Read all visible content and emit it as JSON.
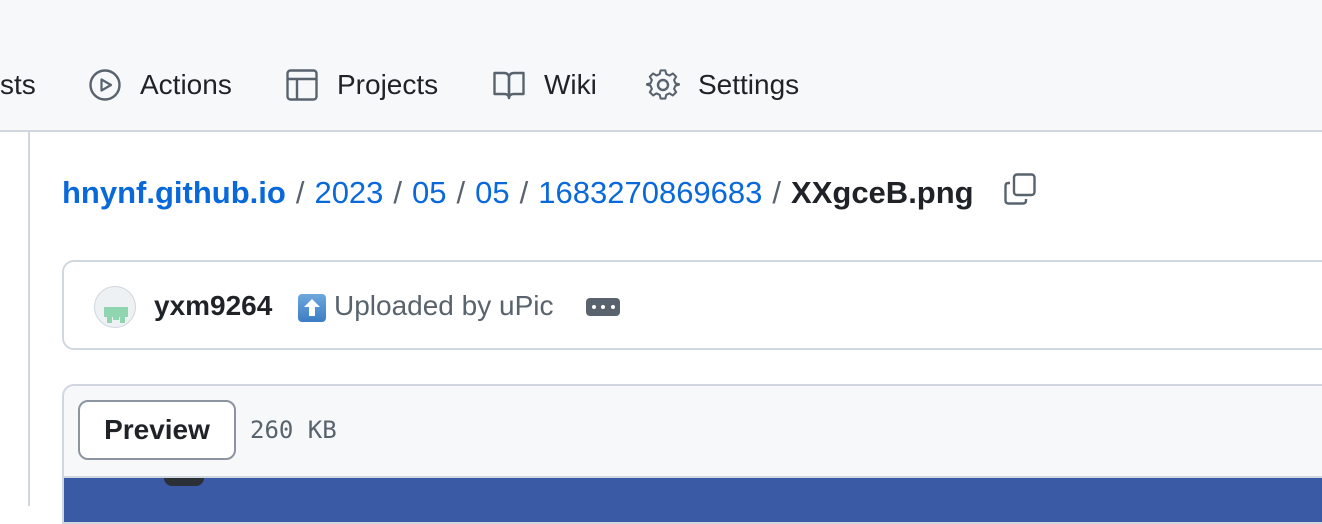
{
  "nav": {
    "items": [
      {
        "label": "sts",
        "icon": "pull-request-icon"
      },
      {
        "label": "Actions",
        "icon": "play-icon"
      },
      {
        "label": "Projects",
        "icon": "table-icon"
      },
      {
        "label": "Wiki",
        "icon": "book-icon"
      },
      {
        "label": "Settings",
        "icon": "gear-icon"
      }
    ]
  },
  "breadcrumb": {
    "repo": "hnynf.github.io",
    "path": [
      "2023",
      "05",
      "05",
      "1683270869683"
    ],
    "current": "XXgceB.png",
    "separator": "/",
    "copy_icon": "copy-icon"
  },
  "commit": {
    "author": "yxm9264",
    "emoji": "up-arrow-emoji",
    "message": "Uploaded by uPic",
    "more_icon": "ellipsis-icon"
  },
  "file": {
    "preview_label": "Preview",
    "size": "260 KB"
  },
  "colors": {
    "link": "#0969da",
    "text": "#1f2328",
    "muted": "#59636e",
    "border": "#d0d7de",
    "topbar_bg": "#f6f8fa",
    "image_preview": "#3a5aa6"
  }
}
